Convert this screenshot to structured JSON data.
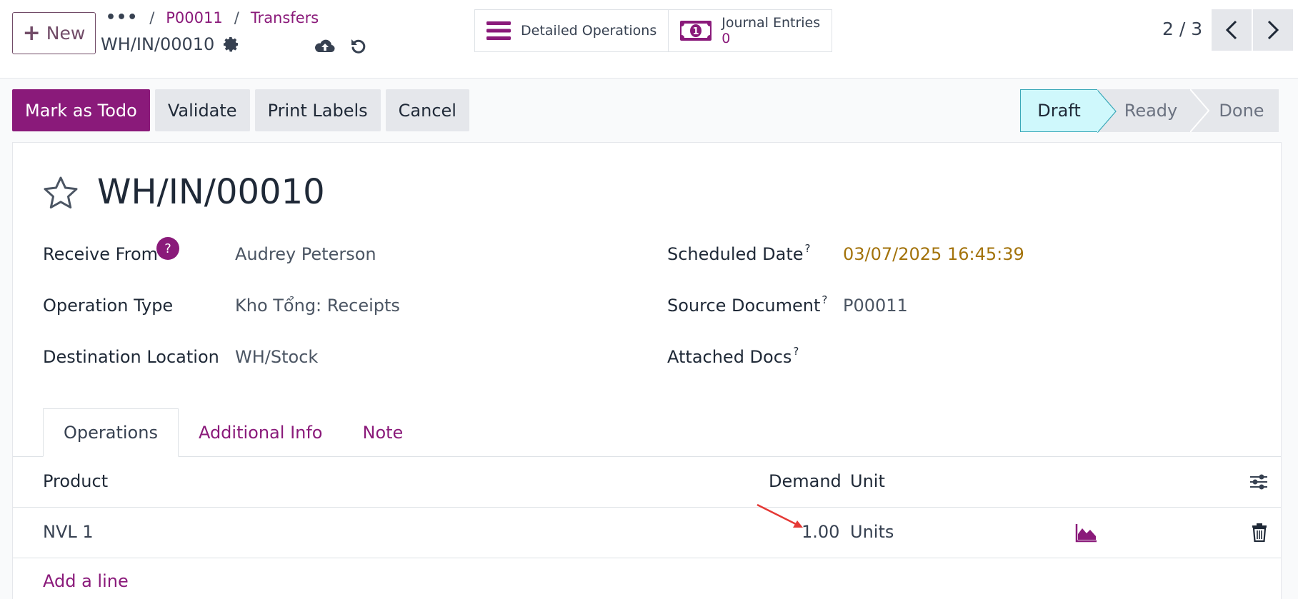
{
  "header": {
    "new_label": "New",
    "breadcrumb": [
      "P00011",
      "Transfers"
    ],
    "record_name": "WH/IN/00010",
    "smart_buttons": {
      "detailed_operations": "Detailed Operations",
      "journal_entries": "Journal Entries",
      "journal_entries_count": "0"
    },
    "pager": "2 / 3"
  },
  "actions": {
    "mark_todo": "Mark as Todo",
    "validate": "Validate",
    "print_labels": "Print Labels",
    "cancel": "Cancel"
  },
  "stages": [
    "Draft",
    "Ready",
    "Done"
  ],
  "form": {
    "title": "WH/IN/00010",
    "fields_left": [
      {
        "label": "Receive From",
        "value": "Audrey Peterson"
      },
      {
        "label": "Operation Type",
        "value": "Kho Tổng: Receipts"
      },
      {
        "label": "Destination Location",
        "value": "WH/Stock"
      }
    ],
    "fields_right": [
      {
        "label": "Scheduled Date",
        "value": "03/07/2025 16:45:39"
      },
      {
        "label": "Source Document",
        "value": "P00011"
      },
      {
        "label": "Attached Docs",
        "value": ""
      }
    ],
    "help_mark": "?"
  },
  "tabs": [
    "Operations",
    "Additional Info",
    "Note"
  ],
  "table": {
    "columns": {
      "product": "Product",
      "demand": "Demand",
      "unit": "Unit"
    },
    "rows": [
      {
        "product": "NVL 1",
        "demand": "1.00",
        "unit": "Units"
      }
    ],
    "add_line": "Add a line"
  },
  "colors": {
    "brand": "#8a1a7a",
    "stage_active": "#cff8fc",
    "date": "#a3730b",
    "annotation_arrow": "#e53935"
  }
}
